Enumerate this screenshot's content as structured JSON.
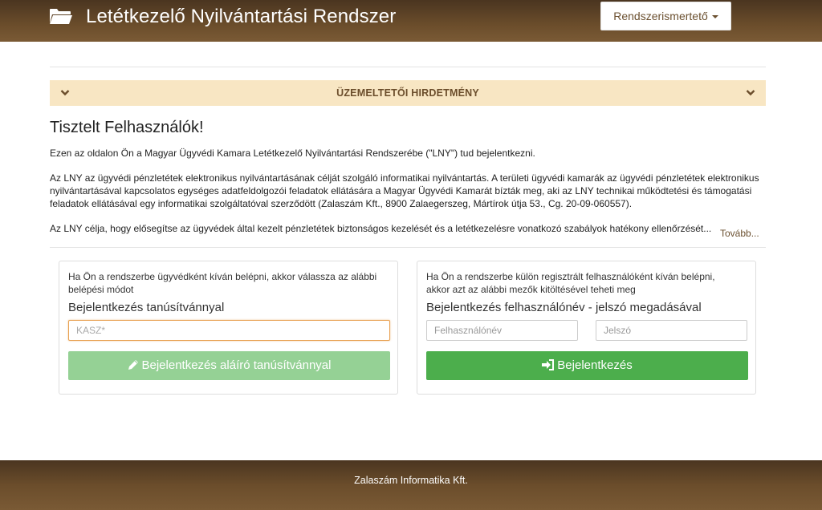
{
  "header": {
    "title": "Letétkezelő Nyilvántartási Rendszer",
    "help_menu": "Rendszerismertető"
  },
  "notice": {
    "title": "ÜZEMELTETŐI HIRDETMÉNY"
  },
  "intro": {
    "greeting": "Tisztelt Felhasználók!",
    "paragraph1": "Ezen az oldalon Ön a Magyar Ügyvédi Kamara Letétkezelő Nyilvántartási Rendszerébe (\"LNY\") tud bejelentkezni.",
    "paragraph2": "Az LNY az ügyvédi pénzletétek elektronikus nyilvántartásának célját szolgáló informatikai nyilvántartás. A területi ügyvédi kamarák az ügyvédi pénzletétek elektronikus nyilvántartásával kapcsolatos egységes adatfeldolgozói feladatok ellátására a Magyar Ügyvédi Kamarát bízták meg, aki az LNY technikai működtetési és támogatási feladatok ellátásával egy informatikai szolgáltatóval szerződött (Zalaszám Kft., 8900 Zalaegerszeg, Mártírok útja 53., Cg. 20-09-060557).",
    "paragraph3": "Az LNY célja, hogy elősegítse az ügyvédek által kezelt pénzletétek biztonságos kezelését és a letétkezelésre vonatkozó szabályok hatékony ellenőrzését...",
    "more_link": "Tovább..."
  },
  "cert_login": {
    "description": "Ha Ön a rendszerbe ügyvédként kíván belépni, akkor válassza az alábbi belépési módot",
    "heading": "Bejelentkezés tanúsítvánnyal",
    "kasz_placeholder": "KASZ*",
    "button_label": "Bejelentkezés aláíró tanúsítvánnyal"
  },
  "user_login": {
    "description": "Ha Ön a rendszerbe külön regisztrált felhasználóként kíván belépni, akkor azt az alábbi mezők kitöltésével teheti meg",
    "heading": "Bejelentkezés felhasználónév - jelszó megadásával",
    "username_placeholder": "Felhasználónév",
    "password_placeholder": "Jelszó",
    "button_label": "Bejelentkezés"
  },
  "footer": {
    "company": "Zalaszám Informatika Kft."
  },
  "colors": {
    "header_brown": "#6b4d2b",
    "notice_bg": "#f8e6c3",
    "success_green": "#4cae4c",
    "disabled_green": "#95d195"
  },
  "icons": {
    "brand": "folder-open-icon",
    "notice": "chevron-down-icon",
    "cert_button": "pencil-icon",
    "login_button": "sign-in-icon"
  }
}
